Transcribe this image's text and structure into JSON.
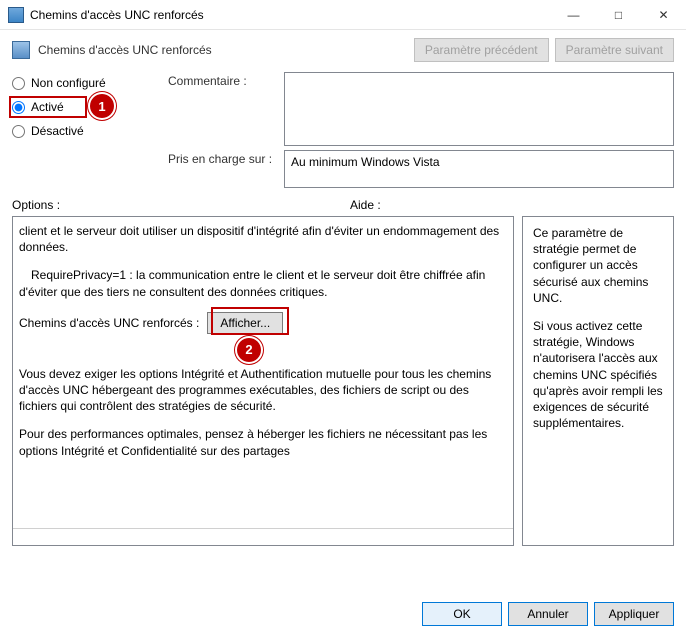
{
  "window": {
    "title": "Chemins d'accès UNC renforcés",
    "header_title": "Chemins d'accès UNC renforcés",
    "prev_btn": "Paramètre précédent",
    "next_btn": "Paramètre suivant"
  },
  "radios": {
    "not_configured": "Non configuré",
    "enabled": "Activé",
    "disabled": "Désactivé",
    "selected": "enabled"
  },
  "labels": {
    "comment": "Commentaire :",
    "supported": "Pris en charge sur :",
    "options": "Options :",
    "help": "Aide :"
  },
  "supported_text": "Au minimum Windows Vista",
  "options": {
    "para1": "client et le serveur doit utiliser un dispositif d'intégrité afin d'éviter un endommagement des données.",
    "para2": "RequirePrivacy=1 : la communication entre le client et le serveur doit être chiffrée afin d'éviter que des tiers ne consultent des données critiques.",
    "show_label": "Chemins d'accès UNC renforcés :",
    "show_btn": "Afficher...",
    "para3": "Vous devez exiger les options Intégrité et Authentification mutuelle pour tous les chemins d'accès UNC hébergeant des programmes exécutables, des fichiers de script ou des fichiers qui contrôlent  des  stratégies  de  sécurité.",
    "para4": "Pour des performances optimales, pensez à  héberger les fichiers ne nécessitant pas les options Intégrité et Confidentialité sur des partages"
  },
  "help": {
    "para1": "Ce paramètre de stratégie permet de configurer un accès sécurisé aux chemins UNC.",
    "para2": "Si vous activez cette stratégie, Windows n'autorisera l'accès aux chemins UNC spécifiés qu'après avoir rempli les exigences de sécurité supplémentaires."
  },
  "footer": {
    "ok": "OK",
    "cancel": "Annuler",
    "apply": "Appliquer"
  },
  "annotations": {
    "badge1": "1",
    "badge2": "2"
  }
}
